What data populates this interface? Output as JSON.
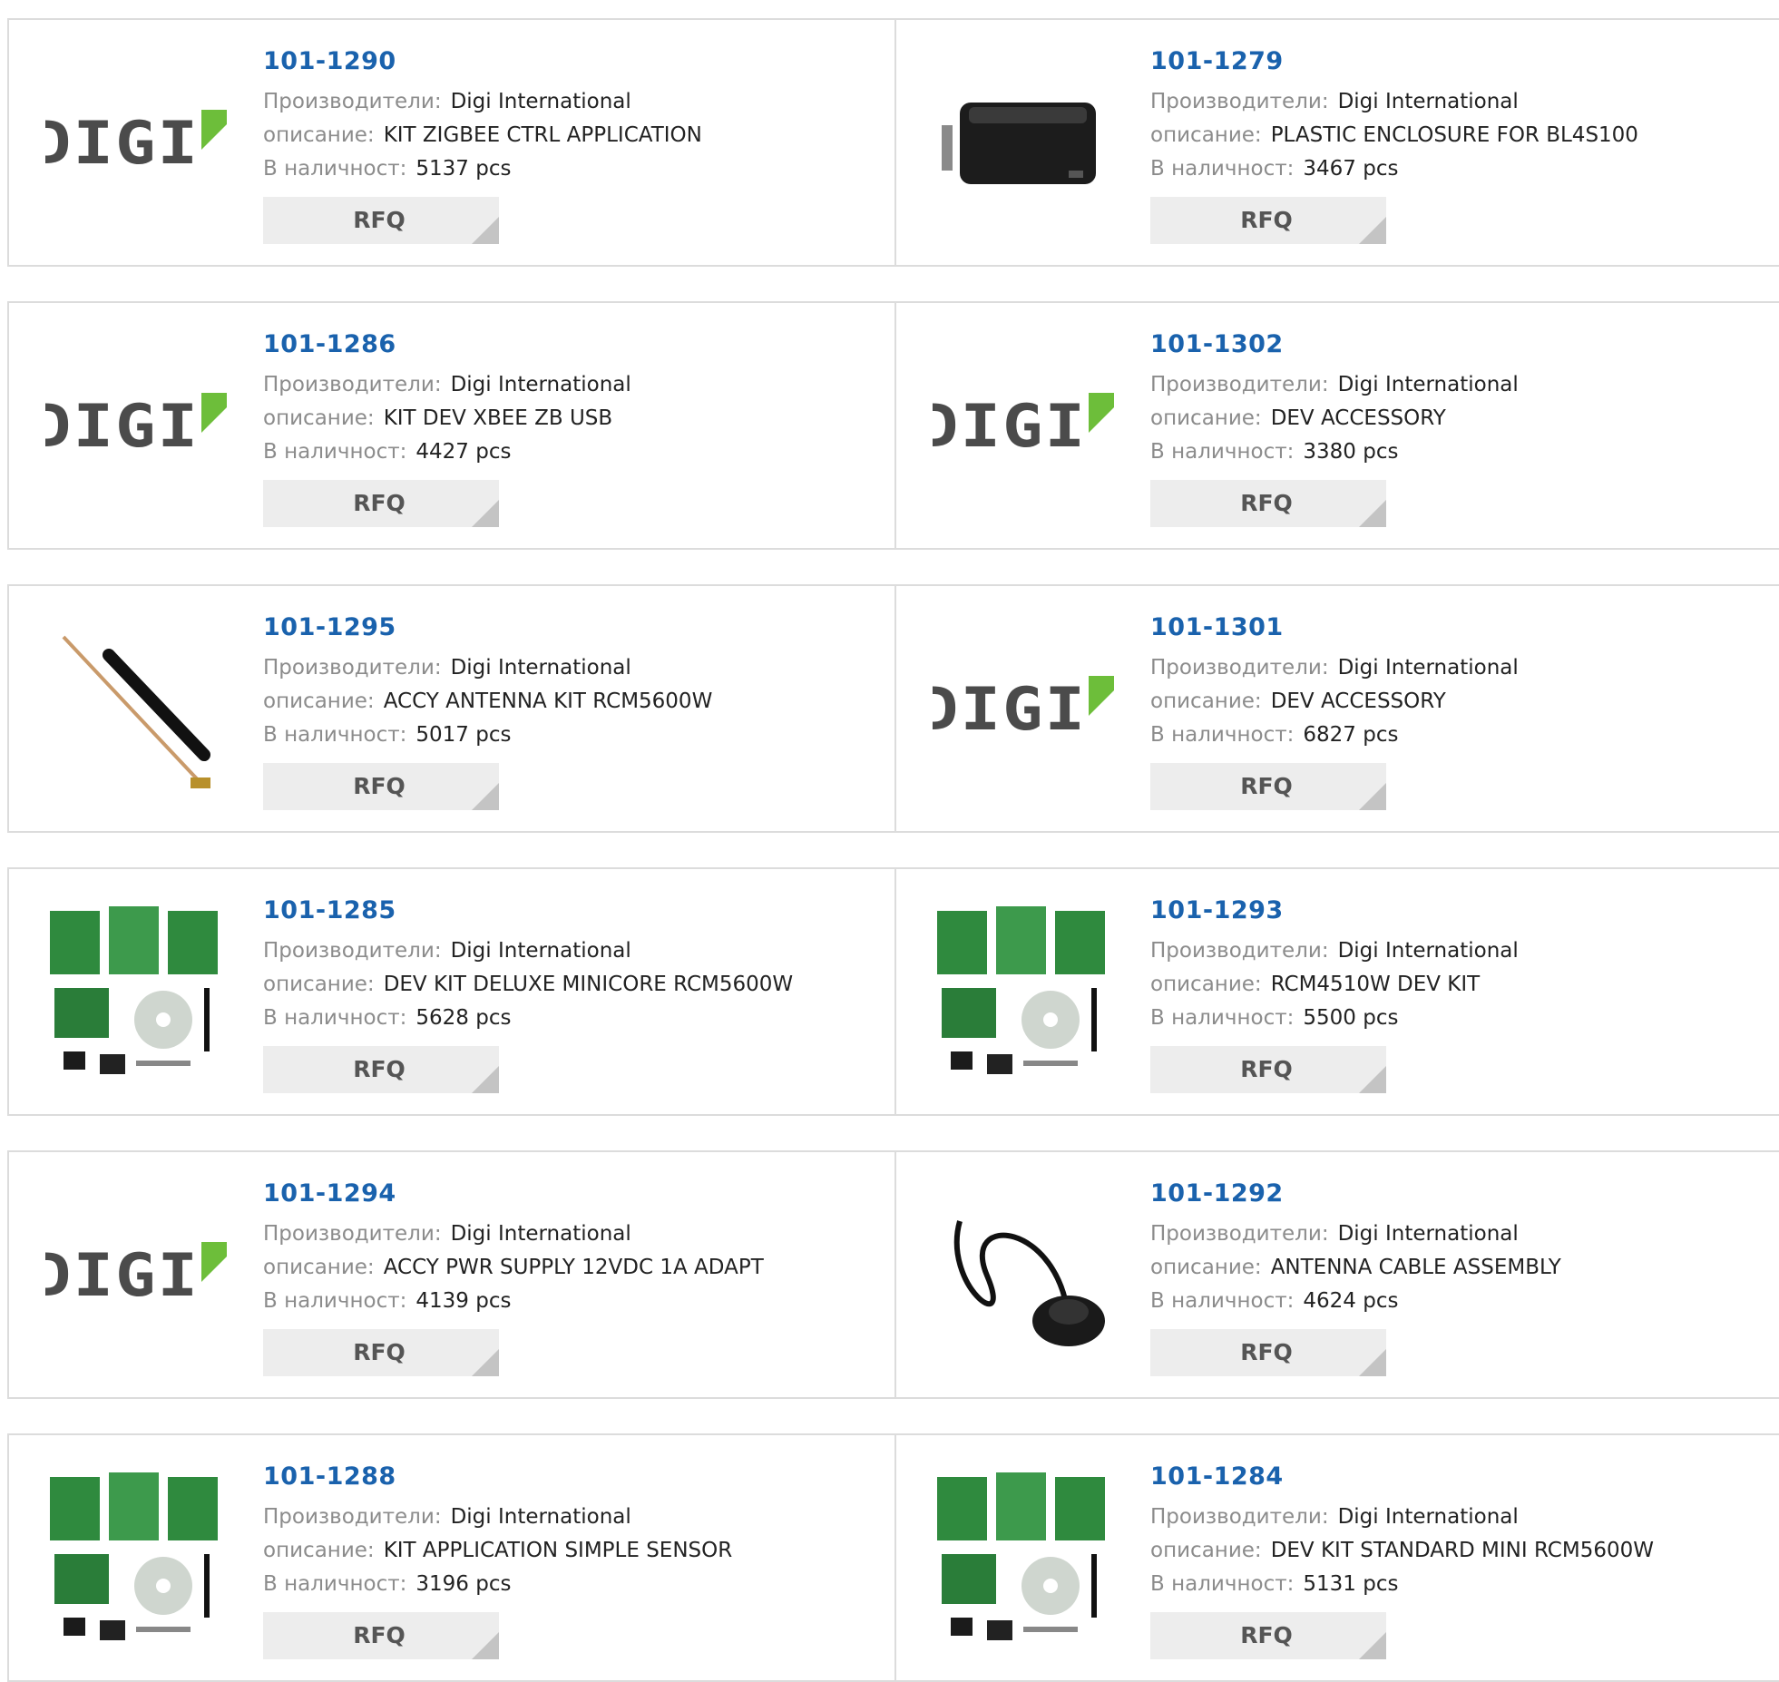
{
  "labels": {
    "manufacturer": "Производители:",
    "description": "описание:",
    "stock": "В наличност:",
    "rfq": "RFQ",
    "logo_text": "DIGI"
  },
  "colors": {
    "part_link": "#1a62ad",
    "logo_green": "#6dbe3a",
    "border": "#dcdcdc",
    "button_bg": "#ededed"
  },
  "products": [
    {
      "part": "101-1290",
      "manufacturer": "Digi International",
      "description": "KIT ZIGBEE CTRL APPLICATION",
      "stock": "5137 pcs",
      "image": "digi-logo"
    },
    {
      "part": "101-1279",
      "manufacturer": "Digi International",
      "description": "PLASTIC ENCLOSURE FOR BL4S100",
      "stock": "3467 pcs",
      "image": "enclosure-photo"
    },
    {
      "part": "101-1286",
      "manufacturer": "Digi International",
      "description": "KIT DEV XBEE ZB USB",
      "stock": "4427 pcs",
      "image": "digi-logo"
    },
    {
      "part": "101-1302",
      "manufacturer": "Digi International",
      "description": "DEV ACCESSORY",
      "stock": "3380 pcs",
      "image": "digi-logo"
    },
    {
      "part": "101-1295",
      "manufacturer": "Digi International",
      "description": "ACCY ANTENNA KIT RCM5600W",
      "stock": "5017 pcs",
      "image": "antenna-photo"
    },
    {
      "part": "101-1301",
      "manufacturer": "Digi International",
      "description": "DEV ACCESSORY",
      "stock": "6827 pcs",
      "image": "digi-logo"
    },
    {
      "part": "101-1285",
      "manufacturer": "Digi International",
      "description": "DEV KIT DELUXE MINICORE RCM5600W",
      "stock": "5628 pcs",
      "image": "dev-kit-photo"
    },
    {
      "part": "101-1293",
      "manufacturer": "Digi International",
      "description": "RCM4510W DEV KIT",
      "stock": "5500 pcs",
      "image": "dev-kit-photo"
    },
    {
      "part": "101-1294",
      "manufacturer": "Digi International",
      "description": "ACCY PWR SUPPLY 12VDC 1A ADAPT",
      "stock": "4139 pcs",
      "image": "digi-logo"
    },
    {
      "part": "101-1292",
      "manufacturer": "Digi International",
      "description": "ANTENNA CABLE ASSEMBLY",
      "stock": "4624 pcs",
      "image": "cable-antenna-photo"
    },
    {
      "part": "101-1288",
      "manufacturer": "Digi International",
      "description": "KIT APPLICATION SIMPLE SENSOR",
      "stock": "3196 pcs",
      "image": "dev-kit-photo"
    },
    {
      "part": "101-1284",
      "manufacturer": "Digi International",
      "description": "DEV KIT STANDARD MINI RCM5600W",
      "stock": "5131 pcs",
      "image": "dev-kit-photo"
    }
  ]
}
